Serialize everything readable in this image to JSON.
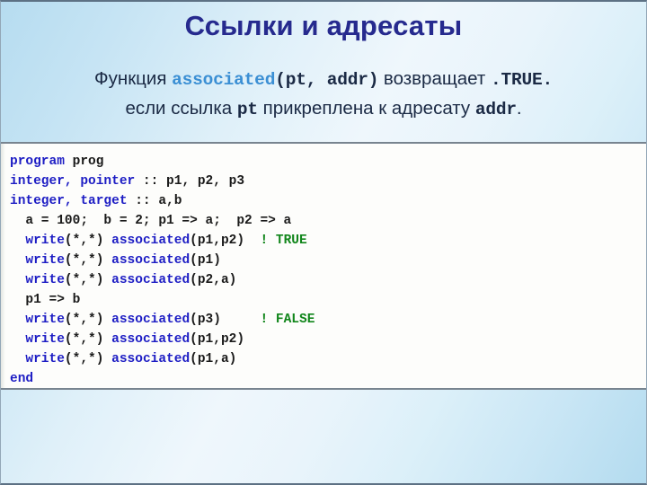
{
  "slide": {
    "title": "Ссылки и адресаты",
    "accent_title_color": "#262a8e",
    "keyword_color": "#1d1dc4",
    "comment_color": "#11861b",
    "function_highlight_color": "#3b8fd4",
    "subtitle": {
      "line1": {
        "prefix": "Функция ",
        "fn_name": "associated",
        "signature": "(pt, addr)",
        "middle": " возвращает ",
        "result": ".TRUE."
      },
      "line2": {
        "prefix": "если ссылка ",
        "var1": "pt",
        "middle": " прикреплена к адресату ",
        "var2": "addr",
        "suffix": "."
      }
    }
  },
  "code": {
    "language": "fortran",
    "lines": [
      {
        "indent": 0,
        "tokens": [
          {
            "t": "program",
            "c": "kw"
          },
          {
            "t": " prog",
            "c": "pl"
          }
        ]
      },
      {
        "indent": 0,
        "tokens": [
          {
            "t": "integer, pointer",
            "c": "kw"
          },
          {
            "t": " :: p1, p2, p3",
            "c": "pl"
          }
        ]
      },
      {
        "indent": 0,
        "tokens": [
          {
            "t": "integer, target",
            "c": "kw"
          },
          {
            "t": " :: a,b",
            "c": "pl"
          }
        ]
      },
      {
        "indent": 2,
        "tokens": [
          {
            "t": "a = 100;  b = 2; p1 => a;  p2 => a",
            "c": "pl"
          }
        ]
      },
      {
        "indent": 2,
        "tokens": [
          {
            "t": "write",
            "c": "kw"
          },
          {
            "t": "(*,*) ",
            "c": "pl"
          },
          {
            "t": "associated",
            "c": "kw"
          },
          {
            "t": "(p1,p2)  ",
            "c": "pl"
          },
          {
            "t": "! TRUE",
            "c": "cmt"
          }
        ]
      },
      {
        "indent": 2,
        "tokens": [
          {
            "t": "write",
            "c": "kw"
          },
          {
            "t": "(*,*) ",
            "c": "pl"
          },
          {
            "t": "associated",
            "c": "kw"
          },
          {
            "t": "(p1)",
            "c": "pl"
          }
        ]
      },
      {
        "indent": 2,
        "tokens": [
          {
            "t": "write",
            "c": "kw"
          },
          {
            "t": "(*,*) ",
            "c": "pl"
          },
          {
            "t": "associated",
            "c": "kw"
          },
          {
            "t": "(p2,a)",
            "c": "pl"
          }
        ]
      },
      {
        "indent": 2,
        "tokens": [
          {
            "t": "p1 => b",
            "c": "pl"
          }
        ]
      },
      {
        "indent": 2,
        "tokens": [
          {
            "t": "write",
            "c": "kw"
          },
          {
            "t": "(*,*) ",
            "c": "pl"
          },
          {
            "t": "associated",
            "c": "kw"
          },
          {
            "t": "(p3)     ",
            "c": "pl"
          },
          {
            "t": "! FALSE",
            "c": "cmt"
          }
        ]
      },
      {
        "indent": 2,
        "tokens": [
          {
            "t": "write",
            "c": "kw"
          },
          {
            "t": "(*,*) ",
            "c": "pl"
          },
          {
            "t": "associated",
            "c": "kw"
          },
          {
            "t": "(p1,p2)",
            "c": "pl"
          }
        ]
      },
      {
        "indent": 2,
        "tokens": [
          {
            "t": "write",
            "c": "kw"
          },
          {
            "t": "(*,*) ",
            "c": "pl"
          },
          {
            "t": "associated",
            "c": "kw"
          },
          {
            "t": "(p1,a)",
            "c": "pl"
          }
        ]
      },
      {
        "indent": 0,
        "tokens": [
          {
            "t": "end",
            "c": "kw"
          }
        ]
      }
    ]
  }
}
